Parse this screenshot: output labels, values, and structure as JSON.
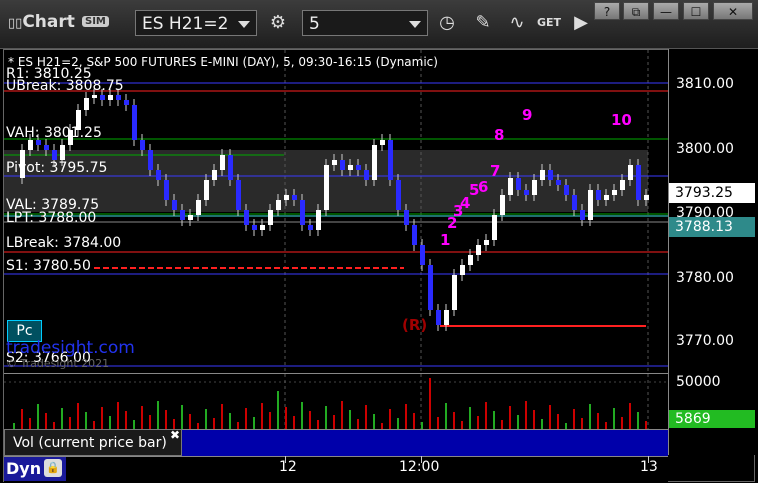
{
  "app": {
    "title": "Chart",
    "mode_badge": "SIM"
  },
  "toolbar": {
    "symbol": "ES H21=2",
    "interval": "5",
    "get_label": "GET"
  },
  "chart": {
    "header": "* ES H21=2, S&P 500 FUTURES E-MINI (DAY), 5, 09:30-16:15 (Dynamic)",
    "levels": [
      {
        "label": "R1: 3810.25",
        "color": "#3a3aff"
      },
      {
        "label": "UBreak: 3808.75",
        "color": "#ff2020"
      },
      {
        "label": "VAH: 3801.25",
        "color": "#00aa00"
      },
      {
        "label": "Pivot: 3795.75",
        "color": "#3a3aff"
      },
      {
        "label": "VAL: 3789.75",
        "color": "#00aa00"
      },
      {
        "label": "LPT: 3788.00",
        "color": "#40e0e0"
      },
      {
        "label": "LBreak: 3784.00",
        "color": "#ff2020"
      },
      {
        "label": "S1: 3780.50",
        "color": "#3a3aff"
      },
      {
        "label": "S2: 3766.00",
        "color": "#3a3aff"
      }
    ],
    "pc_badge": "Pc",
    "watermark": "tradesight.com",
    "watermark_copyright": "© Tradesight 2021",
    "annotation_r": "(R)",
    "count_labels": [
      "1",
      "2",
      "3",
      "4",
      "5",
      "6",
      "7",
      "8",
      "9",
      "10"
    ]
  },
  "price_axis": {
    "ticks": [
      "3810.00",
      "3800.00",
      "3790.00",
      "3780.00",
      "3770.00"
    ],
    "last_price": "3793.25",
    "lpt_price": "3788.13"
  },
  "volume": {
    "axis_tick": "50000",
    "current_value": "5869"
  },
  "study": {
    "label": "Vol (current price bar)"
  },
  "time_axis": {
    "mode": "Dyn",
    "ticks": [
      "12",
      "12:00",
      "13"
    ]
  },
  "colors": {
    "up_candle": "#ffffff",
    "down_candle": "#2a2aff",
    "magenta_counts": "#ff00ff",
    "green_counts": "#00aa00",
    "volume_bar": "#cc0000"
  }
}
